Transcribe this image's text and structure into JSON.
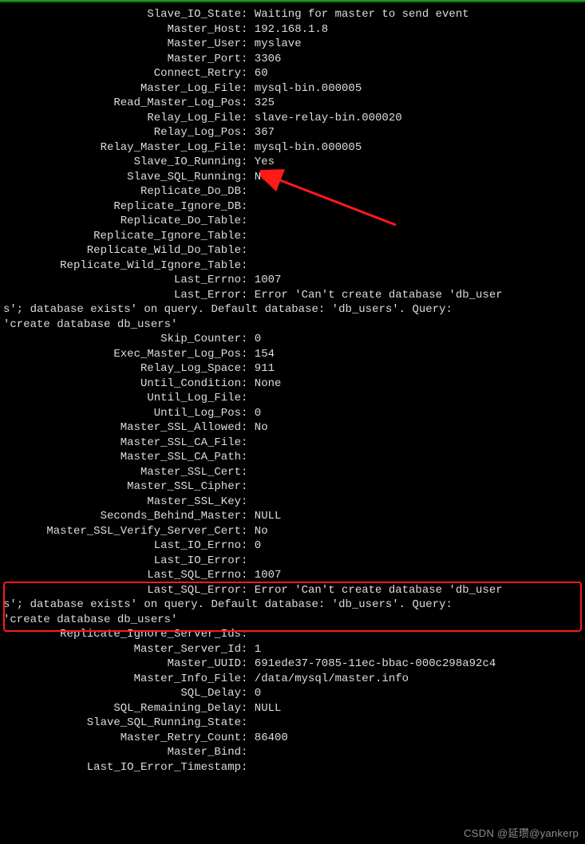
{
  "status": {
    "Slave_IO_State": "Waiting for master to send event",
    "Master_Host": "192.168.1.8",
    "Master_User": "myslave",
    "Master_Port": "3306",
    "Connect_Retry": "60",
    "Master_Log_File": "mysql-bin.000005",
    "Read_Master_Log_Pos": "325",
    "Relay_Log_File": "slave-relay-bin.000020",
    "Relay_Log_Pos": "367",
    "Relay_Master_Log_File": "mysql-bin.000005",
    "Slave_IO_Running": "Yes",
    "Slave_SQL_Running": "No",
    "Replicate_Do_DB": "",
    "Replicate_Ignore_DB": "",
    "Replicate_Do_Table": "",
    "Replicate_Ignore_Table": "",
    "Replicate_Wild_Do_Table": "",
    "Replicate_Wild_Ignore_Table": "",
    "Last_Errno": "1007",
    "Last_Error": "Error 'Can't create database 'db_users'; database exists' on query. Default database: 'db_users'. Query: 'create database db_users'",
    "Skip_Counter": "0",
    "Exec_Master_Log_Pos": "154",
    "Relay_Log_Space": "911",
    "Until_Condition": "None",
    "Until_Log_File": "",
    "Until_Log_Pos": "0",
    "Master_SSL_Allowed": "No",
    "Master_SSL_CA_File": "",
    "Master_SSL_CA_Path": "",
    "Master_SSL_Cert": "",
    "Master_SSL_Cipher": "",
    "Master_SSL_Key": "",
    "Seconds_Behind_Master": "NULL",
    "Master_SSL_Verify_Server_Cert": "No",
    "Last_IO_Errno": "0",
    "Last_IO_Error": "",
    "Last_SQL_Errno": "1007",
    "Last_SQL_Error": "Error 'Can't create database 'db_users'; database exists' on query. Default database: 'db_users'. Query: 'create database db_users'",
    "Replicate_Ignore_Server_Ids": "",
    "Master_Server_Id": "1",
    "Master_UUID": "691ede37-7085-11ec-bbac-000c298a92c4",
    "Master_Info_File": "/data/mysql/master.info",
    "SQL_Delay": "0",
    "SQL_Remaining_Delay": "NULL",
    "Slave_SQL_Running_State": "",
    "Master_Retry_Count": "86400",
    "Master_Bind": "",
    "Last_IO_Error_Timestamp": ""
  },
  "error_block1": {
    "line1_label": "Last_Error",
    "line1_val": "Error 'Can't create database 'db_user",
    "line2": "s'; database exists' on query. Default database: 'db_users'. Query:",
    "line3": "'create database db_users'"
  },
  "error_block2": {
    "line1_label": "Last_SQL_Error",
    "line1_val": "Error 'Can't create database 'db_user",
    "line2": "s'; database exists' on query. Default database: 'db_users'. Query:",
    "line3": "'create database db_users'"
  },
  "order": [
    "Slave_IO_State",
    "Master_Host",
    "Master_User",
    "Master_Port",
    "Connect_Retry",
    "Master_Log_File",
    "Read_Master_Log_Pos",
    "Relay_Log_File",
    "Relay_Log_Pos",
    "Relay_Master_Log_File",
    "Slave_IO_Running",
    "Slave_SQL_Running",
    "Replicate_Do_DB",
    "Replicate_Ignore_DB",
    "Replicate_Do_Table",
    "Replicate_Ignore_Table",
    "Replicate_Wild_Do_Table",
    "Replicate_Wild_Ignore_Table",
    "Last_Errno",
    "__ERRBLOCK1__",
    "Skip_Counter",
    "Exec_Master_Log_Pos",
    "Relay_Log_Space",
    "Until_Condition",
    "Until_Log_File",
    "Until_Log_Pos",
    "Master_SSL_Allowed",
    "Master_SSL_CA_File",
    "Master_SSL_CA_Path",
    "Master_SSL_Cert",
    "Master_SSL_Cipher",
    "Master_SSL_Key",
    "Seconds_Behind_Master",
    "Master_SSL_Verify_Server_Cert",
    "Last_IO_Errno",
    "Last_IO_Error",
    "Last_SQL_Errno",
    "__ERRBLOCK2__",
    "Replicate_Ignore_Server_Ids",
    "Master_Server_Id",
    "Master_UUID",
    "Master_Info_File",
    "SQL_Delay",
    "SQL_Remaining_Delay",
    "Slave_SQL_Running_State",
    "Master_Retry_Count",
    "Master_Bind",
    "Last_IO_Error_Timestamp"
  ],
  "annotation": {
    "arrow_target": "Slave_SQL_Running",
    "highlight_target": "Last_SQL_Error"
  },
  "watermark": "CSDN @延瓒@yankerp"
}
